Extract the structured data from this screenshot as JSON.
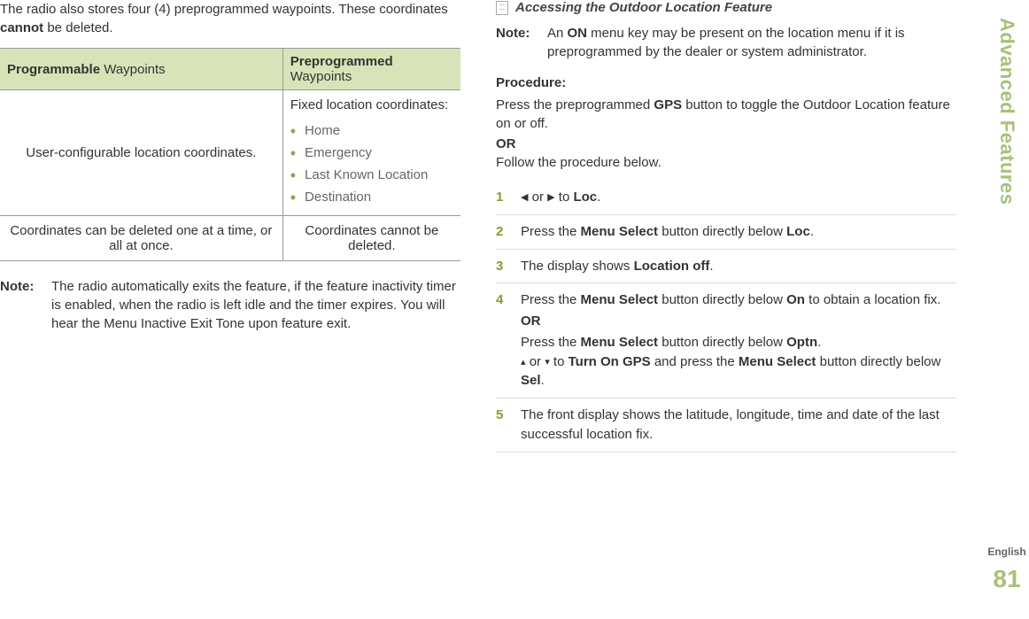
{
  "sidebar": {
    "section_title": "Advanced Features",
    "language": "English",
    "page_number": "81"
  },
  "left": {
    "intro_before": "The radio also stores four (4) preprogrammed waypoints. These coordinates ",
    "intro_bold": "cannot",
    "intro_after": " be deleted.",
    "table": {
      "header_prog_bold": "Programmable",
      "header_prog_rest": " Waypoints",
      "header_pre_bold": "Preprogrammed",
      "header_pre_rest": " Waypoints",
      "row1_left": "User-configurable location coordinates.",
      "row1_right_intro": "Fixed location coordinates:",
      "row1_items": [
        "Home",
        "Emergency",
        "Last Known Location",
        "Destination"
      ],
      "row2_left": "Coordinates can be deleted one at a time, or all at once.",
      "row2_right": "Coordinates cannot be deleted."
    },
    "note_label": "Note:",
    "note_text": "The radio automatically exits the feature, if the feature inactivity timer is enabled, when the radio is left idle and the timer expires. You will hear the Menu Inactive Exit Tone upon feature exit."
  },
  "right": {
    "subheading": "Accessing the Outdoor Location Feature",
    "note_label": "Note:",
    "note_before": "An ",
    "note_bold": "ON",
    "note_after": " menu key may be present on the location menu if it is preprogrammed by the dealer or system administrator.",
    "procedure_label": "Procedure:",
    "proc_line1_before": "Press the preprogrammed ",
    "proc_line1_bold": "GPS",
    "proc_line1_after": " button to toggle the Outdoor Location feature on or off.",
    "proc_or": "OR",
    "proc_line2": "Follow the procedure below.",
    "steps": {
      "s1": {
        "num": "1",
        "left_tri": "◀",
        "mid": " or ",
        "right_tri": "▶",
        "after": " to ",
        "code": "Loc",
        "dot": "."
      },
      "s2": {
        "num": "2",
        "before": "Press the ",
        "bold": "Menu Select",
        "after": " button directly below ",
        "code": "Loc",
        "dot": "."
      },
      "s3": {
        "num": "3",
        "before": "The display shows ",
        "code": "Location off",
        "dot": "."
      },
      "s4": {
        "num": "4",
        "l1_before": "Press the ",
        "l1_bold": "Menu Select",
        "l1_after": " button directly below ",
        "l1_code": "On",
        "l1_tail": " to obtain a location fix.",
        "or": "OR",
        "l2_before": "Press the ",
        "l2_bold": "Menu Select",
        "l2_after": " button directly below ",
        "l2_code": "Optn",
        "l2_dot": ".",
        "l3_up": "▴",
        "l3_mid": " or ",
        "l3_down": "▾",
        "l3_after": " to ",
        "l3_code": "Turn On GPS",
        "l3_tail_before": " and press the ",
        "l3_tail_bold": "Menu Select",
        "l3_tail_after": " button directly below ",
        "l3_sel": "Sel",
        "l3_dot": "."
      },
      "s5": {
        "num": "5",
        "text": "The front display shows the latitude, longitude, time and date of the last successful location fix."
      }
    }
  }
}
